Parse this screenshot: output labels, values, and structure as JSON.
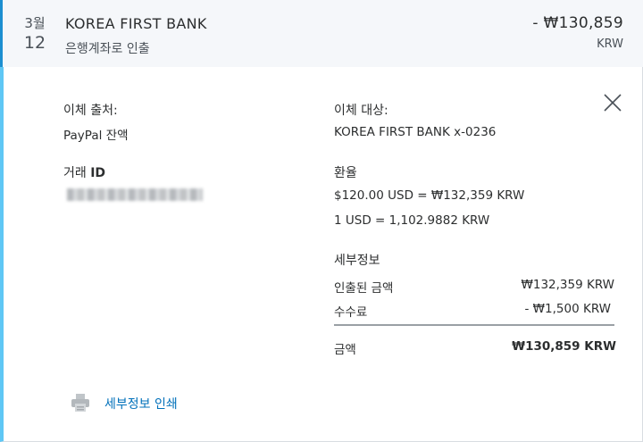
{
  "transaction": {
    "month": "3월",
    "day": "12",
    "merchant": "KOREA FIRST BANK",
    "type": "은행계좌로 인출",
    "amount": "- ₩130,859",
    "currency": "KRW"
  },
  "details": {
    "from_label": "이체 출처:",
    "from_value": "PayPal 잔액",
    "to_label": "이체 대상:",
    "to_value": "KOREA FIRST BANK x-0236",
    "txn_id_label_prefix": "거래 ",
    "txn_id_label_bold": "ID",
    "exchange_label": "환율",
    "exchange_line1": "$120.00 USD = ₩132,359 KRW",
    "exchange_line2": "1 USD = 1,102.9882 KRW",
    "breakdown_label": "세부정보",
    "withdrawn_label": "인출된 금액",
    "withdrawn_value": "₩132,359 KRW",
    "fee_label": "수수료",
    "fee_value": "- ₩1,500 KRW",
    "total_label": "금액",
    "total_value": "₩130,859 KRW",
    "print_label": "세부정보 인쇄"
  },
  "icons": {
    "close": "close-icon",
    "print": "printer-icon"
  },
  "colors": {
    "accent": "#1c8fd1",
    "link": "#0070ba",
    "panel_border": "#5fc7f5"
  }
}
